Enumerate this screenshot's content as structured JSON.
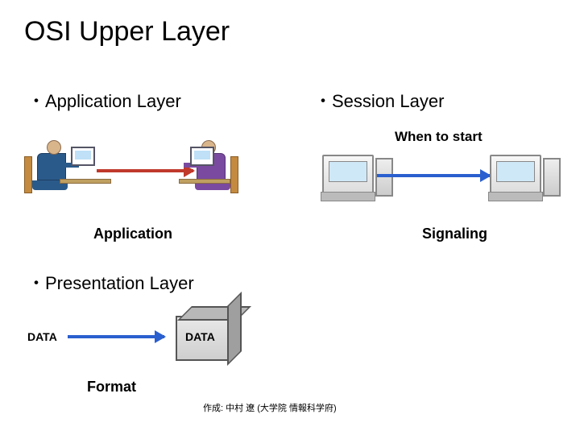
{
  "title": "OSI Upper Layer",
  "left": {
    "app_heading": "・Application Layer",
    "app_label": "Application",
    "pre_heading": "・Presentation Layer",
    "data1": "DATA",
    "data2": "DATA",
    "format": "Format"
  },
  "right": {
    "ses_heading": "・Session Layer",
    "when": "When to start",
    "signaling": "Signaling"
  },
  "credit": "作成: 中村 遼 (大学院 情報科学府)"
}
